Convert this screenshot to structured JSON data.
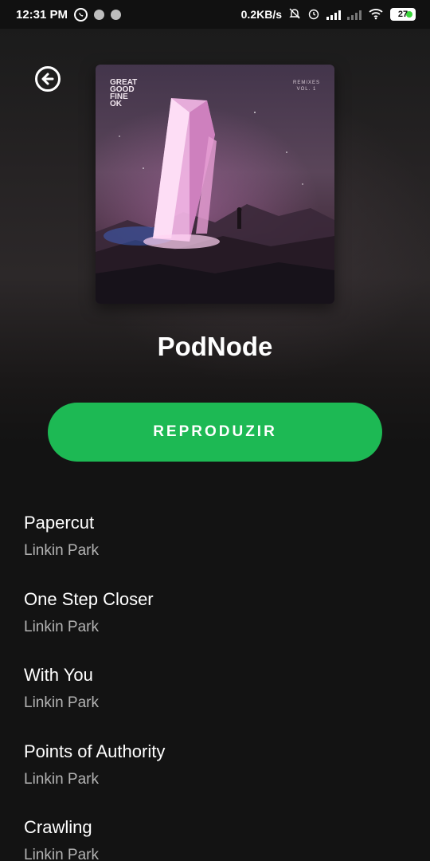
{
  "status_bar": {
    "time": "12:31 PM",
    "net_speed": "0.2KB/s",
    "battery": "27"
  },
  "album": {
    "title": "PodNode",
    "art_logo_lines": [
      "GREAT",
      "GOOD",
      "FINE",
      "OK"
    ],
    "art_remix_line1": "REMIXES",
    "art_remix_line2": "VOL. 1"
  },
  "play_button": {
    "label": "REPRODUZIR"
  },
  "tracks": [
    {
      "title": "Papercut",
      "artist": "Linkin Park"
    },
    {
      "title": "One Step Closer",
      "artist": "Linkin Park"
    },
    {
      "title": "With You",
      "artist": "Linkin Park"
    },
    {
      "title": "Points of Authority",
      "artist": "Linkin Park"
    },
    {
      "title": "Crawling",
      "artist": "Linkin Park"
    }
  ],
  "colors": {
    "background": "#131313",
    "accent": "#1db954",
    "secondary_text": "#b3b3b3"
  },
  "icons": {
    "back": "back-arrow-circle-icon",
    "whatsapp": "whatsapp-icon",
    "mute": "bell-off-icon",
    "alarm": "alarm-icon",
    "wifi": "wifi-icon"
  }
}
